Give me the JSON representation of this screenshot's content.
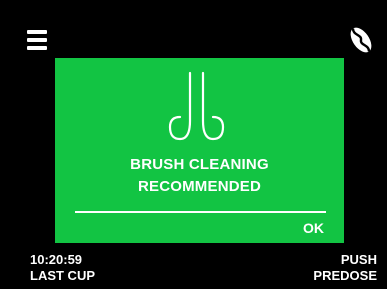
{
  "colors": {
    "background": "#000000",
    "dialog": "#12c443",
    "foreground": "#ffffff"
  },
  "header": {
    "menu_icon": "hamburger-menu-icon",
    "bean_icon": "coffee-bean-icon"
  },
  "dialog": {
    "icon": "brush-icon",
    "message_line1": "BRUSH CLEANING",
    "message_line2": "RECOMMENDED",
    "ok_label": "OK"
  },
  "footer": {
    "time": "10:20:59",
    "last_cup_label": "LAST CUP",
    "push_label": "PUSH",
    "predose_label": "PREDOSE"
  }
}
